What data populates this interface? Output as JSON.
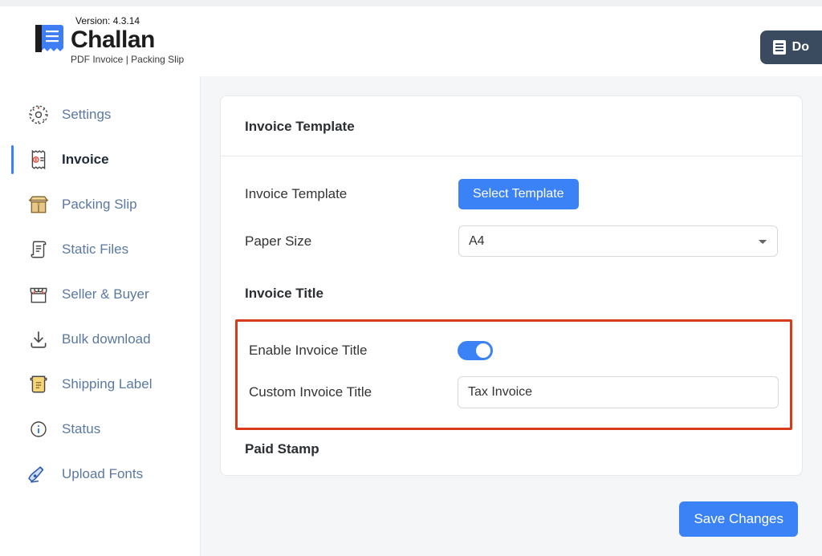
{
  "app": {
    "version_label": "Version: 4.3.14",
    "title": "Challan",
    "subtitle": "PDF Invoice | Packing Slip"
  },
  "header": {
    "doc_button": "Do"
  },
  "sidebar": {
    "items": [
      {
        "label": "Settings"
      },
      {
        "label": "Invoice"
      },
      {
        "label": "Packing Slip"
      },
      {
        "label": "Static Files"
      },
      {
        "label": "Seller & Buyer"
      },
      {
        "label": "Bulk download"
      },
      {
        "label": "Shipping Label"
      },
      {
        "label": "Status"
      },
      {
        "label": "Upload Fonts"
      }
    ]
  },
  "main": {
    "section_header": "Invoice Template",
    "template_label": "Invoice Template",
    "select_template_button": "Select Template",
    "paper_size_label": "Paper Size",
    "paper_size_value": "A4",
    "invoice_title_section": "Invoice Title",
    "enable_title_label": "Enable Invoice Title",
    "enable_title_on": true,
    "custom_title_label": "Custom Invoice Title",
    "custom_title_value": "Tax Invoice",
    "paid_stamp_section": "Paid Stamp",
    "save_button": "Save Changes"
  }
}
